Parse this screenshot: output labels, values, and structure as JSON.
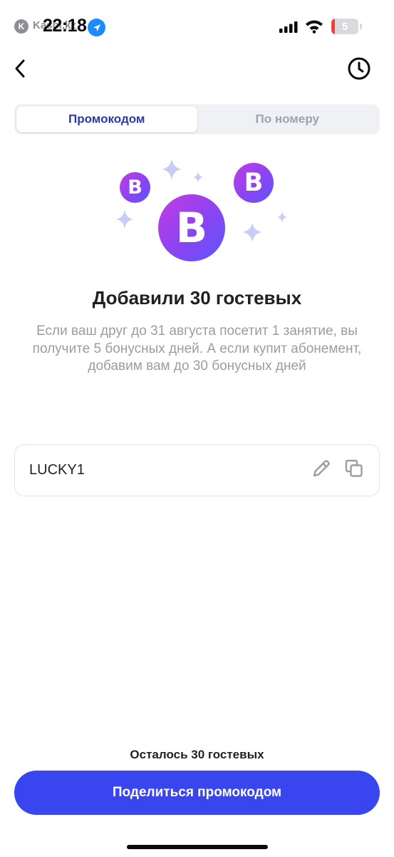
{
  "status_bar": {
    "carrier": "Kaspi.kz",
    "time": "22:18",
    "battery": "5",
    "icons": [
      "kaspi-logo-icon",
      "location-arrow-icon",
      "signal-icon",
      "wifi-icon",
      "battery-icon"
    ]
  },
  "nav": {
    "back_icon": "chevron-left-icon",
    "history_icon": "clock-icon"
  },
  "tabs": [
    {
      "label": "Промокодом",
      "active": true
    },
    {
      "label": "По номеру",
      "active": false
    }
  ],
  "illustration": {
    "coin_letter": "B",
    "icons": [
      "coin-icon",
      "sparkle-icon"
    ]
  },
  "headline": "Добавили 30 гостевых",
  "description": "Если ваш друг до 31 августа посетит 1 занятие, вы получите 5 бонусных дней. А если купит абонемент, добавим вам до 30 бонусных дней",
  "promo": {
    "code": "LUCKY1",
    "edit_icon": "pencil-icon",
    "copy_icon": "copy-icon"
  },
  "remaining": "Осталось 30 гостевых",
  "share_button": "Поделиться промокодом",
  "colors": {
    "accent": "#3946f0",
    "tab_active_text": "#2a3aa8",
    "coin_gradient_start": "#c23ce6",
    "coin_gradient_end": "#5a57ff",
    "sparkle": "#c9cdf5",
    "muted_text": "#9a9ca6"
  }
}
